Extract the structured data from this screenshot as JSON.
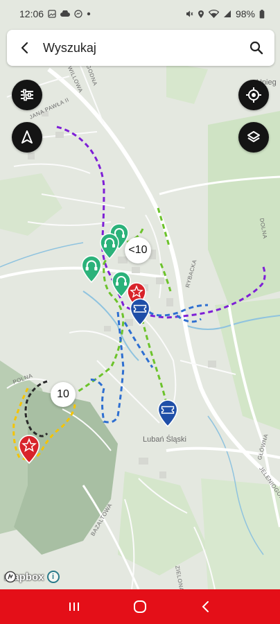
{
  "status_bar": {
    "time": "12:06",
    "battery": "98%",
    "left_icons": [
      "image-icon",
      "cloud-icon",
      "messenger-icon",
      "dot-icon"
    ],
    "right_icons": [
      "mute-icon",
      "location-icon",
      "wifi-icon",
      "signal-icon",
      "battery-icon"
    ]
  },
  "search": {
    "placeholder": "Wyszukaj",
    "back_icon": "back-arrow-icon",
    "search_icon": "search-icon"
  },
  "map_controls": {
    "left": [
      "filter-icon",
      "navigation-arrow-icon"
    ],
    "right": [
      "locate-icon",
      "layers-icon"
    ]
  },
  "map": {
    "streets": [
      "POGODNA",
      "WILLOWA",
      "JANA PAWŁA II",
      "RYBACKA",
      "POLNA",
      "BAZALTOWA",
      "GŁÓWNA",
      "JELENIOGÓRSKA",
      "DOLNA",
      "ZIELONA"
    ],
    "town": "Lubań Śląski",
    "edge_label": "Unieg",
    "clusters": [
      "<10",
      "10"
    ],
    "colors": {
      "purple_route": "#7e1fd6",
      "green_route": "#6cc32b",
      "blue_route": "#2e6fd1",
      "yellow_route": "#f5c400",
      "dark_route": "#2a2a2a",
      "teal_marker": "#2bb27a",
      "red_marker": "#d8232a",
      "blue_marker": "#1f4ea7"
    }
  },
  "attribution": {
    "logo": "mapbox",
    "info": "i"
  },
  "nav_bar": {
    "color": "#e40f18",
    "buttons": [
      "recent-apps-icon",
      "home-icon",
      "back-icon"
    ]
  }
}
